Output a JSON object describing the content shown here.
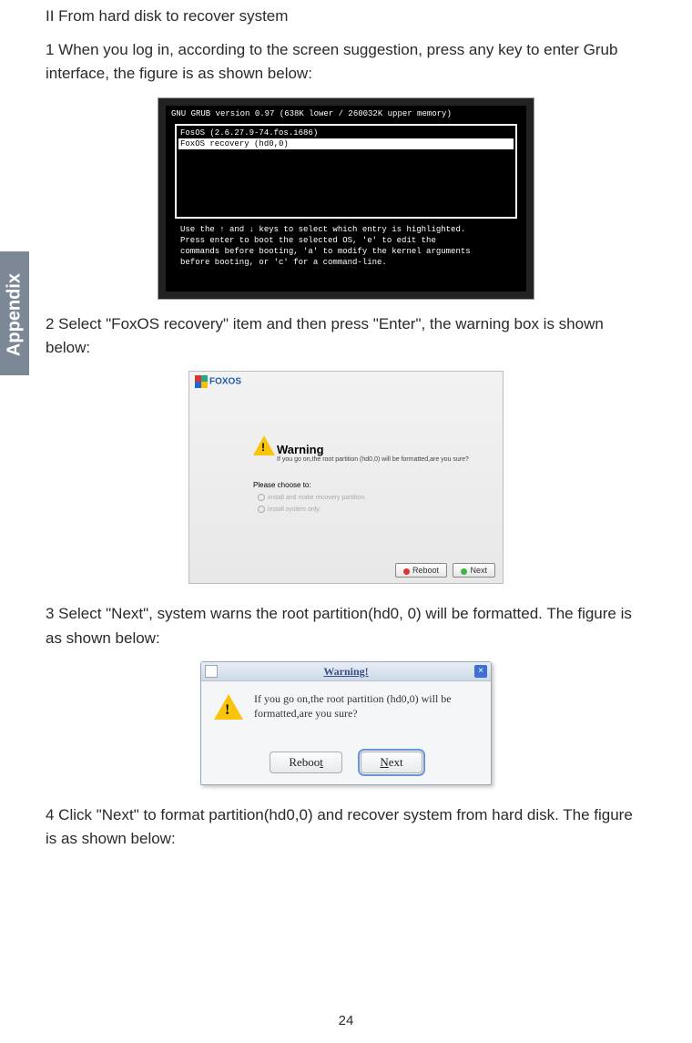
{
  "sidetab": "Appendix",
  "heading": "II  From hard disk to recover system",
  "p1": "1  When you log in, according to the screen suggestion, press any key to enter Grub interface, the figure is as shown below:",
  "grub": {
    "title": "GNU GRUB  version 0.97   (638K lower / 260032K upper memory)",
    "item1": "FosOS (2.6.27.9-74.fos.i686)",
    "item2": "FoxOS recovery (hd0,0)",
    "help1": "Use the ↑ and ↓ keys to select which entry is highlighted.",
    "help2": "Press enter to boot the selected OS, 'e' to edit the",
    "help3": "commands before booting, 'a' to modify the kernel arguments",
    "help4": "before booting, or 'c' for a command-line."
  },
  "p2": "2  Select \"FoxOS  recovery\" item and then press \"Enter\", the warning box is shown below:",
  "fox": {
    "logo": "FOXOS",
    "warning_label": "Warning",
    "warning_text": "If you go on,the root partition (hd0,0) will be formatted,are you sure?",
    "choose": "Please choose to:",
    "opt1": "install and make recovery partition.",
    "opt2": "install system only.",
    "reboot": "Reboot",
    "next": "Next"
  },
  "p3": "3  Select \"Next\", system warns the root partition(hd0, 0) will be formatted. The figure is as shown below:",
  "dlg": {
    "title": "Warning!",
    "msg": "If you go on,the root partition (hd0,0) will be formatted,are you sure?",
    "reboot_pre": "Reboo",
    "reboot_u": "t",
    "next_u": "N",
    "next_post": "ext"
  },
  "p4": "4 Click \"Next\" to format partition(hd0,0) and recover system from hard disk. The figure is as shown below:",
  "page_number": "24"
}
